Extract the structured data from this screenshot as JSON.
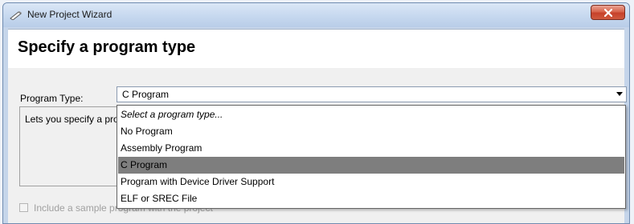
{
  "window": {
    "title": "New Project Wizard",
    "icon": "wand-icon",
    "close_icon": "close-icon"
  },
  "header": {
    "title": "Specify a program type"
  },
  "form": {
    "program_type_label": "Program Type:",
    "program_type_value": "C Program",
    "description": "Lets you specify a program type for the project",
    "include_sample_label": "Include a sample program with the project",
    "include_sample_checked": false,
    "include_sample_enabled": false
  },
  "dropdown": {
    "items": [
      {
        "label": "Select a program type...",
        "style": "placeholder"
      },
      {
        "label": "No Program"
      },
      {
        "label": "Assembly Program"
      },
      {
        "label": "C Program",
        "selected": true
      },
      {
        "label": "Program with Device Driver Support"
      },
      {
        "label": "ELF or SREC File"
      }
    ]
  },
  "colors": {
    "close_button": "#c6412a",
    "selected_item": "#7e7e7e"
  }
}
